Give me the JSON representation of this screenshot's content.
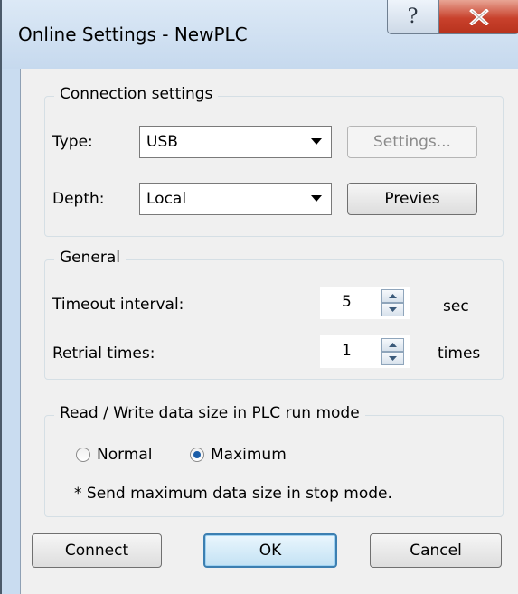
{
  "window": {
    "title": "Online Settings - NewPLC"
  },
  "title_buttons": {
    "help_icon": "help-icon",
    "close_icon": "close-icon"
  },
  "connection": {
    "legend": "Connection settings",
    "type_label": "Type:",
    "type_value": "USB",
    "settings_button": "Settings...",
    "depth_label": "Depth:",
    "depth_value": "Local",
    "preview_button": "Previes"
  },
  "general": {
    "legend": "General",
    "timeout_label": "Timeout interval:",
    "timeout_value": "5",
    "timeout_unit": "sec",
    "retrial_label": "Retrial times:",
    "retrial_value": "1",
    "retrial_unit": "times"
  },
  "rw_mode": {
    "legend": "Read / Write data size in PLC run mode",
    "option_normal": "Normal",
    "option_maximum": "Maximum",
    "selected": "Maximum",
    "note": "* Send maximum data size in stop mode."
  },
  "buttons": {
    "connect": "Connect",
    "ok": "OK",
    "cancel": "Cancel"
  }
}
